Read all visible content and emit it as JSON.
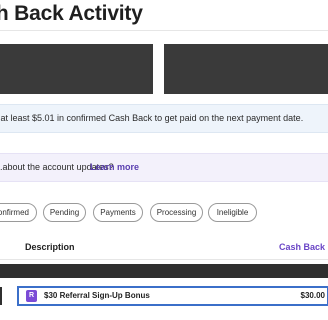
{
  "header": {
    "title": "Cash Back Activity"
  },
  "notice": {
    "text": "...at least $5.01 in confirmed Cash Back to get paid on the next payment date."
  },
  "update_banner": {
    "question": "...about the account updates?",
    "link": "Learn more"
  },
  "filters": [
    "Confirmed",
    "Pending",
    "Payments",
    "Processing",
    "Ineligible"
  ],
  "table": {
    "columns": {
      "description": "Description",
      "cash_back": "Cash Back"
    },
    "rows": [
      {
        "badge": "R",
        "description": "$30 Referral Sign-Up Bonus",
        "amount": "$30.00"
      }
    ]
  }
}
